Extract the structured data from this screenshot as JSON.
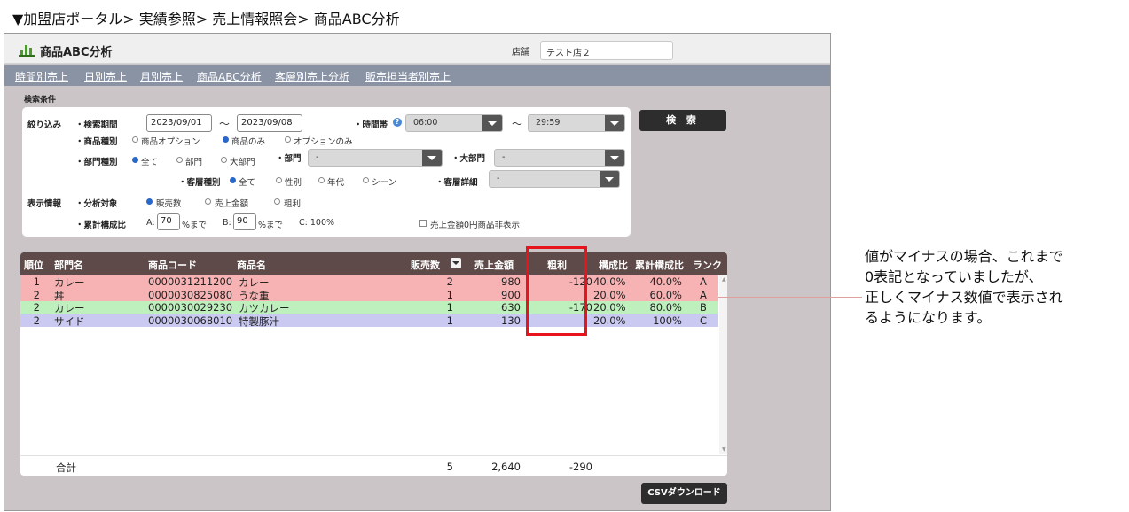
{
  "breadcrumb": "▼加盟店ポータル> 実績参照> 売上情報照会> 商品ABC分析",
  "window": {
    "title": "商品ABC分析",
    "store_label": "店舗",
    "store_value": "テスト店２"
  },
  "nav": [
    "時間別売上",
    "日別売上",
    "月別売上",
    "商品ABC分析",
    "客層別売上分析",
    "販売担当者別売上"
  ],
  "conditions": {
    "title": "検索条件",
    "filter_label": "絞り込み",
    "period_label": "・検索期間",
    "date_from": "2023/09/01",
    "date_sep": "～",
    "date_to": "2023/09/08",
    "time_label": "・時間帯",
    "time_from": "06:00",
    "time_sep": "～",
    "time_to": "29:59",
    "product_type_label": "・商品種別",
    "product_type_options": [
      "商品オプション",
      "商品のみ",
      "オプションのみ"
    ],
    "dept_type_label": "・部門種別",
    "dept_type_options": [
      "全て",
      "部門",
      "大部門"
    ],
    "dept_label": "・部門",
    "dept_value": "-",
    "major_dept_label": "・大部門",
    "major_dept_value": "-",
    "customer_type_label": "・客層種別",
    "customer_type_options": [
      "全て",
      "性別",
      "年代",
      "シーン"
    ],
    "customer_detail_label": "・客層詳細",
    "customer_detail_value": "-",
    "display_label": "表示情報",
    "target_label": "・分析対象",
    "target_options": [
      "販売数",
      "売上金額",
      "粗利"
    ],
    "ratio_label": "・累計構成比",
    "ratio_a_prefix": "A:",
    "ratio_a": "70",
    "ratio_a_suffix": "%まで",
    "ratio_b_prefix": "B:",
    "ratio_b": "90",
    "ratio_b_suffix": "%まで",
    "ratio_c": "C: 100%",
    "hide_zero_label": "売上金額0円商品非表示"
  },
  "search_button": "検 索",
  "table": {
    "headers": [
      "順位",
      "部門名",
      "商品コード",
      "商品名",
      "販売数",
      "売上金額",
      "粗利",
      "構成比",
      "累計構成比",
      "ランク"
    ],
    "rows": [
      {
        "rank": "1",
        "dept": "カレー",
        "code": "0000031211200",
        "name": "カレー",
        "qty": "2",
        "sales": "980",
        "profit": "-120",
        "ratio": "40.0%",
        "cum": "40.0%",
        "abc": "A",
        "color": "#f7b3b3"
      },
      {
        "rank": "2",
        "dept": "丼",
        "code": "0000030825080",
        "name": "うな重",
        "qty": "1",
        "sales": "900",
        "profit": "",
        "ratio": "20.0%",
        "cum": "60.0%",
        "abc": "A",
        "color": "#f7b3b3"
      },
      {
        "rank": "2",
        "dept": "カレー",
        "code": "0000030029230",
        "name": "カツカレー",
        "qty": "1",
        "sales": "630",
        "profit": "-170",
        "ratio": "20.0%",
        "cum": "80.0%",
        "abc": "B",
        "color": "#bdf0bd"
      },
      {
        "rank": "2",
        "dept": "サイド",
        "code": "0000030068010",
        "name": "特製豚汁",
        "qty": "1",
        "sales": "130",
        "profit": "",
        "ratio": "20.0%",
        "cum": "100%",
        "abc": "C",
        "color": "#c9c9f2"
      }
    ],
    "total_label": "合計",
    "total_qty": "5",
    "total_sales": "2,640",
    "total_profit": "-290"
  },
  "csv_button": "CSVダウンロード",
  "note": [
    "値がマイナスの場合、これまで",
    "0表記となっていましたが、",
    "正しくマイナス数値で表示され",
    "るようになります。"
  ],
  "colors": {
    "header_bg": "#5e4b49",
    "nav_bg": "#8a93a4",
    "window_bg": "#cbc5c8",
    "highlight": "#e8141c"
  }
}
